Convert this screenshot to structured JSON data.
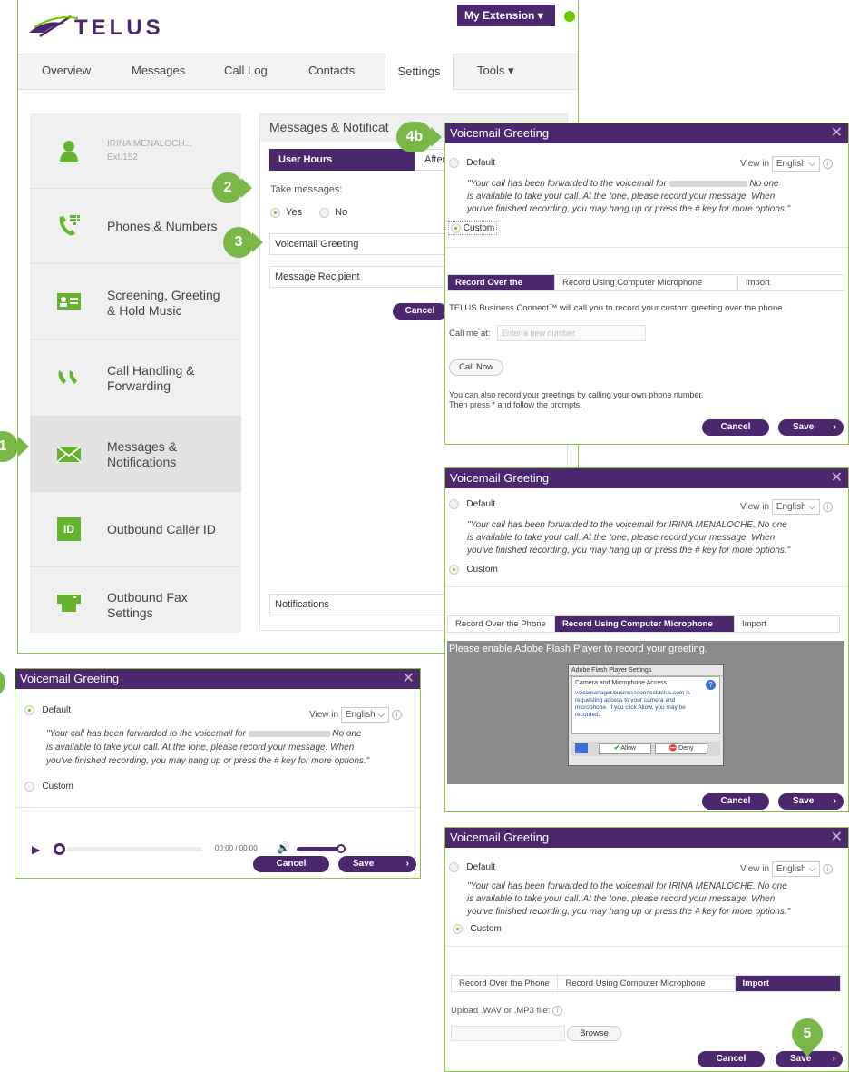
{
  "header": {
    "logo": "TELUS",
    "extension_menu": "My Extension",
    "status_color": "#66cc00"
  },
  "nav": {
    "tabs": [
      "Overview",
      "Messages",
      "Call Log",
      "Contacts",
      "Settings",
      "Tools"
    ]
  },
  "sidebar": {
    "user_name": "IRINA MENALOCH...",
    "user_ext": "Ext.152",
    "items": [
      {
        "label": "Phones & Numbers",
        "icon": "phone-keypad-icon"
      },
      {
        "label": "Screening, Greeting\n& Hold Music",
        "icon": "id-card-icon"
      },
      {
        "label": "Call Handling &\nForwarding",
        "icon": "forward-call-icon"
      },
      {
        "label": "Messages &\nNotifications",
        "icon": "envelope-icon"
      },
      {
        "label": "Outbound Caller ID",
        "icon": "id-badge-icon"
      },
      {
        "label": "Outbound Fax\nSettings",
        "icon": "fax-icon"
      }
    ]
  },
  "main": {
    "title": "Messages & Notificat",
    "tab_user_hours": "User Hours",
    "tab_after": "After",
    "take_messages": "Take messages:",
    "yes": "Yes",
    "no": "No",
    "voicemail_greeting": "Voicemail Greeting",
    "message_recipient": "Message Recipient",
    "cancel": "Cancel",
    "notifications": "Notifications"
  },
  "badges": {
    "b1": "1",
    "b2": "2",
    "b3": "3",
    "b4b": "4b",
    "b5": "5"
  },
  "dialog": {
    "title": "Voicemail Greeting",
    "default": "Default",
    "custom": "Custom",
    "view_in": "View in",
    "language": "English",
    "quote_1": "\"Your call has been forwarded to the voicemail for",
    "quote_1b": "No one",
    "quote_2": "is available to take your call. At the tone, please record your message. When",
    "quote_3": "you've finished recording, you may hang up or press the # key for more options.\"",
    "quote_full": "\"Your call has been forwarded to the voicemail for IRINA MENALOCHE. No one",
    "cancel": "Cancel",
    "save": "Save",
    "tab_phone": "Record Over the Phone",
    "tab_mic": "Record Using Computer Microphone",
    "tab_import": "Import"
  },
  "dialog_phone": {
    "info": "TELUS Business Connect™ will call you to record your custom greeting over the phone.",
    "call_me_at": "Call me at:",
    "placeholder": "Enter a new number",
    "call_now": "Call Now",
    "note_1": "You can also record your greetings by calling your own phone number.",
    "note_2": "Then press * and follow the prompts."
  },
  "dialog_mic": {
    "flash_msg": "Please enable Adobe Flash Player to record your greeting.",
    "flash_title": "Adobe Flash Player Settings",
    "flash_sub": "Camera and Microphone Access",
    "flash_text": "voicemanager.businessconnect.telus.com is requesting access to your camera and microphone. If you click Allow, you may be recorded.",
    "allow": "Allow",
    "deny": "Deny"
  },
  "dialog_default": {
    "time": "00:00 / 00:00"
  },
  "dialog_import": {
    "upload": "Upload .WAV or .MP3 file:",
    "browse": "Browse"
  }
}
